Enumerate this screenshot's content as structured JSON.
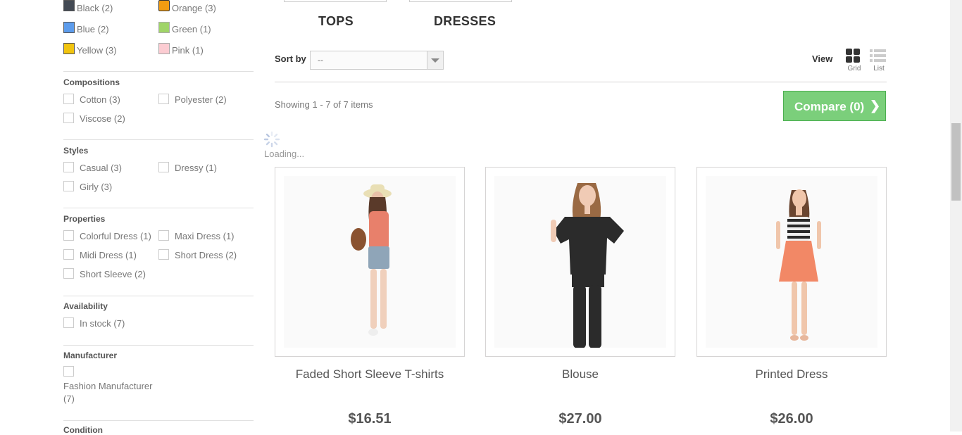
{
  "colors": {
    "items": [
      {
        "label": "Black (2)",
        "color": "#434a54"
      },
      {
        "label": "Orange (3)",
        "color": "#f39c11"
      },
      {
        "label": "Blue (2)",
        "color": "#5d9cec"
      },
      {
        "label": "Green (1)",
        "color": "#a0d468"
      },
      {
        "label": "Yellow (3)",
        "color": "#f1c40f"
      },
      {
        "label": "Pink (1)",
        "color": "#fcccd2"
      }
    ]
  },
  "compositions": {
    "title": "Compositions",
    "items": [
      "Cotton (3)",
      "Polyester (2)",
      "Viscose (2)"
    ]
  },
  "styles": {
    "title": "Styles",
    "items": [
      "Casual (3)",
      "Dressy (1)",
      "Girly (3)"
    ]
  },
  "properties": {
    "title": "Properties",
    "items": [
      "Colorful Dress (1)",
      "Maxi Dress (1)",
      "Midi Dress (1)",
      "Short Dress (2)",
      "Short Sleeve (2)"
    ]
  },
  "availability": {
    "title": "Availability",
    "items": [
      "In stock (7)"
    ]
  },
  "manufacturer": {
    "title": "Manufacturer",
    "item_line1": "Fashion Manufacturer",
    "item_line2": "(7)"
  },
  "condition": {
    "title": "Condition"
  },
  "subcategories": [
    "TOPS",
    "DRESSES"
  ],
  "sort": {
    "label": "Sort by",
    "value": "--"
  },
  "view": {
    "label": "View",
    "grid": "Grid",
    "list": "List"
  },
  "showing": "Showing 1 - 7 of 7 items",
  "compare": {
    "label": "Compare (0)",
    "chevron": "❯"
  },
  "loading": "Loading...",
  "products": [
    {
      "name": "Faded Short Sleeve T-shirts",
      "price": "$16.51"
    },
    {
      "name": "Blouse",
      "price": "$27.00"
    },
    {
      "name": "Printed Dress",
      "price": "$26.00"
    }
  ],
  "accent": "#7bcf7b"
}
